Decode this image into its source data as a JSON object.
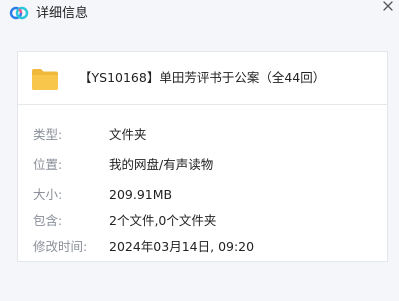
{
  "window": {
    "title": "详细信息",
    "logo_icon": "cloud-logo-icon",
    "close_icon": "close-icon"
  },
  "file": {
    "icon": "folder-icon",
    "name": "【YS10168】单田芳评书于公案（全44回）"
  },
  "details": [
    {
      "label": "类型:",
      "value": "文件夹"
    },
    {
      "label": "位置:",
      "value": "我的网盘/有声读物"
    },
    {
      "label": "大小:",
      "value": "209.91MB"
    },
    {
      "label": "包含:",
      "value": "2个文件,0个文件夹"
    },
    {
      "label": "修改时间:",
      "value": "2024年03月14日, 09:20"
    }
  ],
  "colors": {
    "background": "#f4f6fa",
    "folder": "#f8c64a",
    "logo_blue": "#2b7de9",
    "logo_cyan": "#29c6d8",
    "logo_pink": "#f25a8c"
  }
}
